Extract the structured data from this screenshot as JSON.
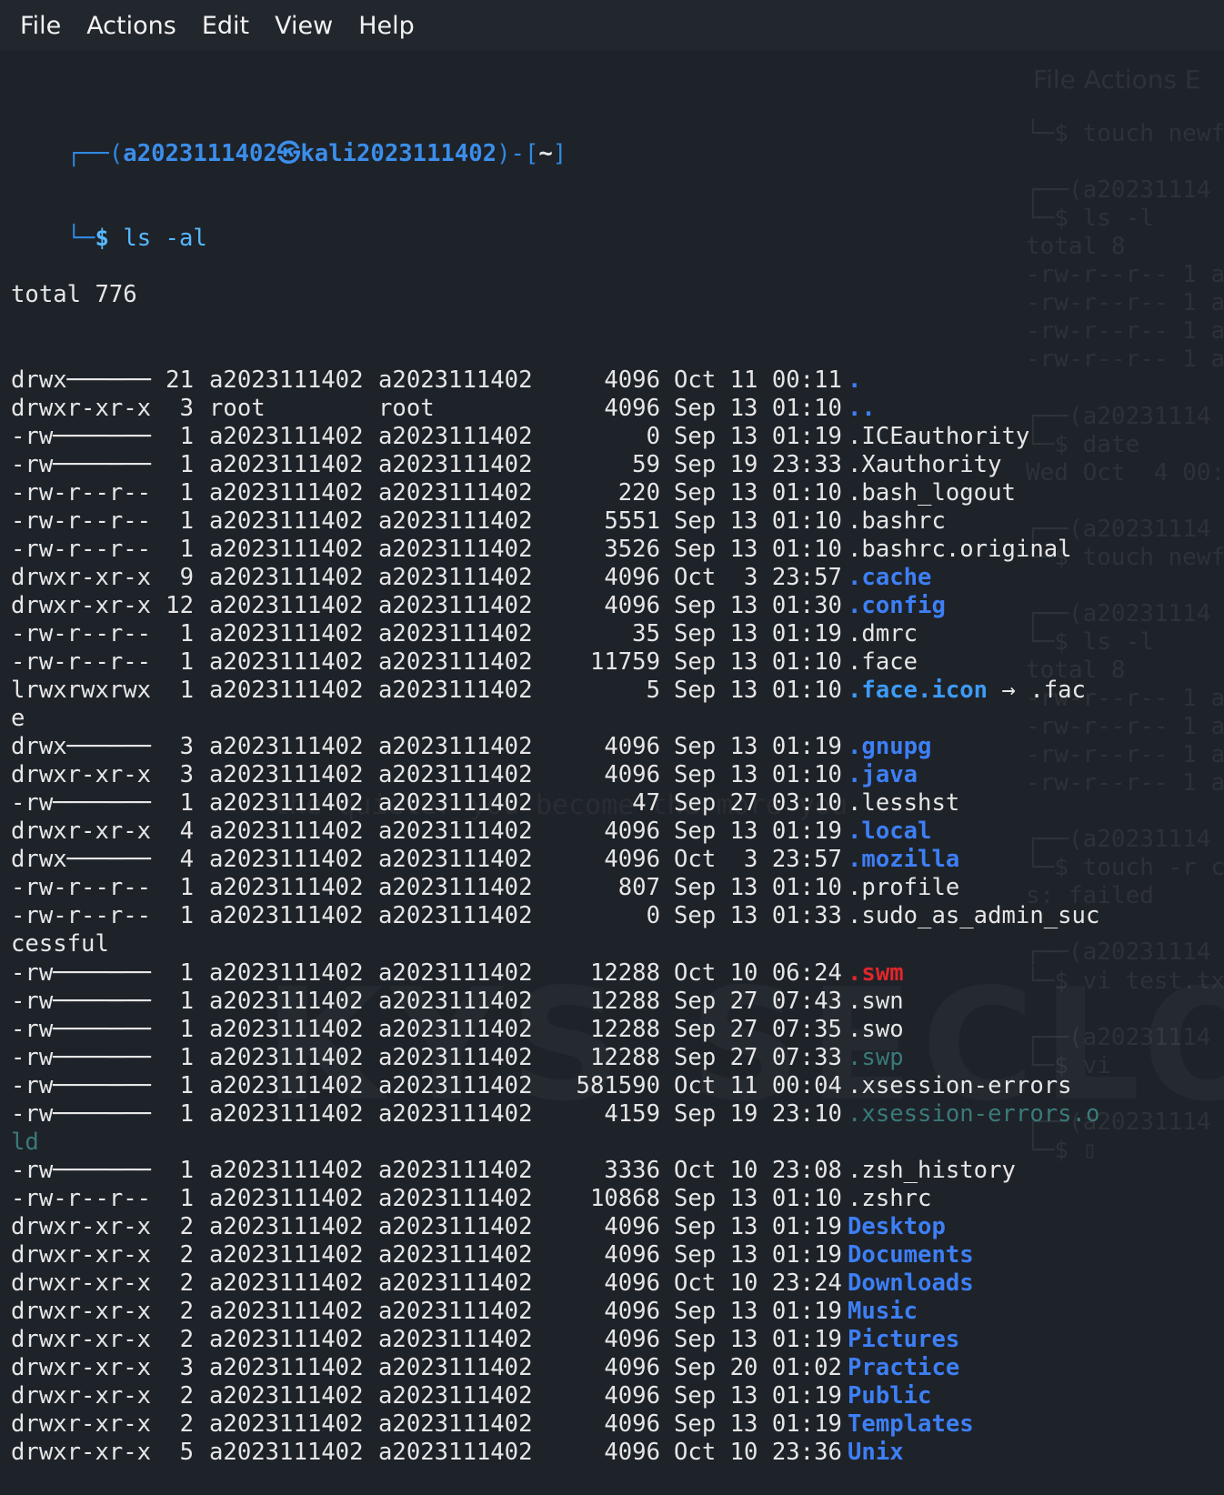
{
  "menu": [
    "File",
    "Actions",
    "Edit",
    "View",
    "Help"
  ],
  "prompt": {
    "top_frame": "┌──(",
    "user": "a2023111402",
    "at": "㉿",
    "host": "kali2023111402",
    "close_frame": ")-[",
    "dir": "~",
    "end_frame": "]",
    "bottom_frame": "└─",
    "symbol": "$",
    "command": "ls -al"
  },
  "total_line": "total 776",
  "listing": [
    {
      "perm": "drwx──────",
      "links": "21",
      "owner": "a2023111402",
      "group": "a2023111402",
      "size": "4096",
      "date": "Oct 11 00:11",
      "name": ".",
      "type": "dir"
    },
    {
      "perm": "drwxr-xr-x",
      "links": "3",
      "owner": "root",
      "group": "root",
      "size": "4096",
      "date": "Sep 13 01:10",
      "name": "..",
      "type": "dir"
    },
    {
      "perm": "-rw───────",
      "links": "1",
      "owner": "a2023111402",
      "group": "a2023111402",
      "size": "0",
      "date": "Sep 13 01:19",
      "name": ".ICEauthority",
      "type": "file"
    },
    {
      "perm": "-rw───────",
      "links": "1",
      "owner": "a2023111402",
      "group": "a2023111402",
      "size": "59",
      "date": "Sep 19 23:33",
      "name": ".Xauthority",
      "type": "file"
    },
    {
      "perm": "-rw-r--r--",
      "links": "1",
      "owner": "a2023111402",
      "group": "a2023111402",
      "size": "220",
      "date": "Sep 13 01:10",
      "name": ".bash_logout",
      "type": "file"
    },
    {
      "perm": "-rw-r--r--",
      "links": "1",
      "owner": "a2023111402",
      "group": "a2023111402",
      "size": "5551",
      "date": "Sep 13 01:10",
      "name": ".bashrc",
      "type": "file"
    },
    {
      "perm": "-rw-r--r--",
      "links": "1",
      "owner": "a2023111402",
      "group": "a2023111402",
      "size": "3526",
      "date": "Sep 13 01:10",
      "name": ".bashrc.original",
      "type": "file"
    },
    {
      "perm": "drwxr-xr-x",
      "links": "9",
      "owner": "a2023111402",
      "group": "a2023111402",
      "size": "4096",
      "date": "Oct  3 23:57",
      "name": ".cache",
      "type": "dir"
    },
    {
      "perm": "drwxr-xr-x",
      "links": "12",
      "owner": "a2023111402",
      "group": "a2023111402",
      "size": "4096",
      "date": "Sep 13 01:30",
      "name": ".config",
      "type": "dir"
    },
    {
      "perm": "-rw-r--r--",
      "links": "1",
      "owner": "a2023111402",
      "group": "a2023111402",
      "size": "35",
      "date": "Sep 13 01:19",
      "name": ".dmrc",
      "type": "file"
    },
    {
      "perm": "-rw-r--r--",
      "links": "1",
      "owner": "a2023111402",
      "group": "a2023111402",
      "size": "11759",
      "date": "Sep 13 01:10",
      "name": ".face",
      "type": "file"
    },
    {
      "perm": "lrwxrwxrwx",
      "links": "1",
      "owner": "a2023111402",
      "group": "a2023111402",
      "size": "5",
      "date": "Sep 13 01:10",
      "name": ".face.icon",
      "type": "link",
      "arrow": " → ",
      "target": ".fac",
      "wrap": "e"
    },
    {
      "perm": "drwx──────",
      "links": "3",
      "owner": "a2023111402",
      "group": "a2023111402",
      "size": "4096",
      "date": "Sep 13 01:19",
      "name": ".gnupg",
      "type": "dir"
    },
    {
      "perm": "drwxr-xr-x",
      "links": "3",
      "owner": "a2023111402",
      "group": "a2023111402",
      "size": "4096",
      "date": "Sep 13 01:10",
      "name": ".java",
      "type": "dir"
    },
    {
      "perm": "-rw───────",
      "links": "1",
      "owner": "a2023111402",
      "group": "a2023111402",
      "size": "47",
      "date": "Sep 27 03:10",
      "name": ".lesshst",
      "type": "file"
    },
    {
      "perm": "drwxr-xr-x",
      "links": "4",
      "owner": "a2023111402",
      "group": "a2023111402",
      "size": "4096",
      "date": "Sep 13 01:19",
      "name": ".local",
      "type": "dir"
    },
    {
      "perm": "drwx──────",
      "links": "4",
      "owner": "a2023111402",
      "group": "a2023111402",
      "size": "4096",
      "date": "Oct  3 23:57",
      "name": ".mozilla",
      "type": "dir"
    },
    {
      "perm": "-rw-r--r--",
      "links": "1",
      "owner": "a2023111402",
      "group": "a2023111402",
      "size": "807",
      "date": "Sep 13 01:10",
      "name": ".profile",
      "type": "file"
    },
    {
      "perm": "-rw-r--r--",
      "links": "1",
      "owner": "a2023111402",
      "group": "a2023111402",
      "size": "0",
      "date": "Sep 13 01:33",
      "name": ".sudo_as_admin_suc",
      "type": "file",
      "wrap": "cessful"
    },
    {
      "perm": "-rw───────",
      "links": "1",
      "owner": "a2023111402",
      "group": "a2023111402",
      "size": "12288",
      "date": "Oct 10 06:24",
      "name": ".swm",
      "type": "red"
    },
    {
      "perm": "-rw───────",
      "links": "1",
      "owner": "a2023111402",
      "group": "a2023111402",
      "size": "12288",
      "date": "Sep 27 07:43",
      "name": ".swn",
      "type": "file"
    },
    {
      "perm": "-rw───────",
      "links": "1",
      "owner": "a2023111402",
      "group": "a2023111402",
      "size": "12288",
      "date": "Sep 27 07:35",
      "name": ".swo",
      "type": "file"
    },
    {
      "perm": "-rw───────",
      "links": "1",
      "owner": "a2023111402",
      "group": "a2023111402",
      "size": "12288",
      "date": "Sep 27 07:33",
      "name": ".swp",
      "type": "dim"
    },
    {
      "perm": "-rw───────",
      "links": "1",
      "owner": "a2023111402",
      "group": "a2023111402",
      "size": "581590",
      "date": "Oct 11 00:04",
      "name": ".xsession-errors",
      "type": "file"
    },
    {
      "perm": "-rw───────",
      "links": "1",
      "owner": "a2023111402",
      "group": "a2023111402",
      "size": "4159",
      "date": "Sep 19 23:10",
      "name": ".xsession-errors.o",
      "type": "dim",
      "wrap": "ld"
    },
    {
      "perm": "-rw───────",
      "links": "1",
      "owner": "a2023111402",
      "group": "a2023111402",
      "size": "3336",
      "date": "Oct 10 23:08",
      "name": ".zsh_history",
      "type": "file"
    },
    {
      "perm": "-rw-r--r--",
      "links": "1",
      "owner": "a2023111402",
      "group": "a2023111402",
      "size": "10868",
      "date": "Sep 13 01:10",
      "name": ".zshrc",
      "type": "file"
    },
    {
      "perm": "drwxr-xr-x",
      "links": "2",
      "owner": "a2023111402",
      "group": "a2023111402",
      "size": "4096",
      "date": "Sep 13 01:19",
      "name": "Desktop",
      "type": "dir"
    },
    {
      "perm": "drwxr-xr-x",
      "links": "2",
      "owner": "a2023111402",
      "group": "a2023111402",
      "size": "4096",
      "date": "Sep 13 01:19",
      "name": "Documents",
      "type": "dir"
    },
    {
      "perm": "drwxr-xr-x",
      "links": "2",
      "owner": "a2023111402",
      "group": "a2023111402",
      "size": "4096",
      "date": "Oct 10 23:24",
      "name": "Downloads",
      "type": "dir"
    },
    {
      "perm": "drwxr-xr-x",
      "links": "2",
      "owner": "a2023111402",
      "group": "a2023111402",
      "size": "4096",
      "date": "Sep 13 01:19",
      "name": "Music",
      "type": "dir"
    },
    {
      "perm": "drwxr-xr-x",
      "links": "2",
      "owner": "a2023111402",
      "group": "a2023111402",
      "size": "4096",
      "date": "Sep 13 01:19",
      "name": "Pictures",
      "type": "dir"
    },
    {
      "perm": "drwxr-xr-x",
      "links": "3",
      "owner": "a2023111402",
      "group": "a2023111402",
      "size": "4096",
      "date": "Sep 20 01:02",
      "name": "Practice",
      "type": "dir"
    },
    {
      "perm": "drwxr-xr-x",
      "links": "2",
      "owner": "a2023111402",
      "group": "a2023111402",
      "size": "4096",
      "date": "Sep 13 01:19",
      "name": "Public",
      "type": "dir"
    },
    {
      "perm": "drwxr-xr-x",
      "links": "2",
      "owner": "a2023111402",
      "group": "a2023111402",
      "size": "4096",
      "date": "Sep 13 01:19",
      "name": "Templates",
      "type": "dir"
    },
    {
      "perm": "drwxr-xr-x",
      "links": "5",
      "owner": "a2023111402",
      "group": "a2023111402",
      "size": "4096",
      "date": "Oct 10 23:36",
      "name": "Unix",
      "type": "dir"
    }
  ],
  "background_window": {
    "menu": "File  Actions  E",
    "lines": [
      "└─$ touch newf",
      "",
      "┌──(a20231114",
      "└─$ ls -l",
      "total 8",
      "-rw-r--r-- 1 a",
      "-rw-r--r-- 1 a",
      "-rw-r--r-- 1 a",
      "-rw-r--r-- 1 a",
      "",
      "┌──(a20231114",
      "└─$ date",
      "Wed Oct  4 00:",
      "",
      "┌──(a20231114",
      "└─$ touch newf",
      "",
      "┌──(a20231114",
      "└─$ ls -l",
      "total 8",
      "-rw-r--r-- 1 a",
      "-rw-r--r-- 1 a",
      "-rw-r--r-- 1 a",
      "-rw-r--r-- 1 a",
      "",
      "┌──(a20231114",
      "└─$ touch -r c",
      "s: failed",
      "",
      "┌──(a20231114",
      "└─$ vi test.tx",
      "",
      "┌──(a20231114",
      "└─$ vi",
      "",
      "┌──(a20231114",
      "└─$ ▯"
    ]
  },
  "watermark": "KYS SECLOC",
  "watermark_sub": "the quieter you become the more you"
}
